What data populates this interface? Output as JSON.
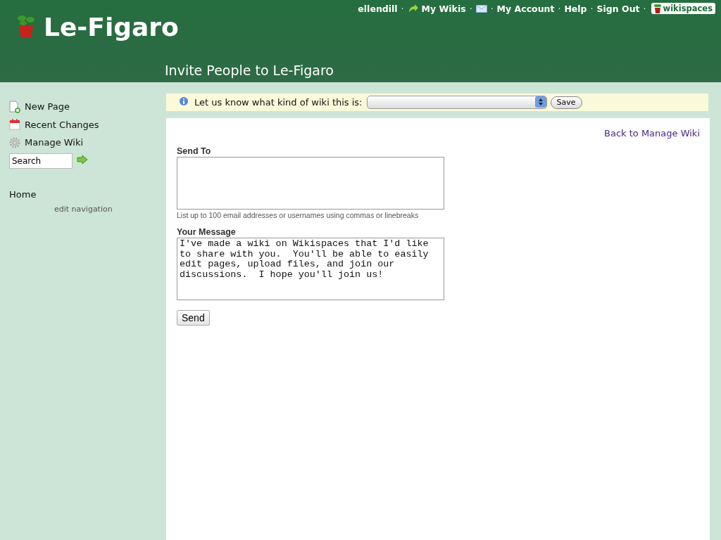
{
  "header": {
    "site_title": "Le-Figaro",
    "page_title": "Invite People to Le-Figaro",
    "user_nav": [
      {
        "kind": "user",
        "label": "ellendill"
      },
      {
        "kind": "separator",
        "label": "·"
      },
      {
        "kind": "arrow_link",
        "label": "My Wikis"
      },
      {
        "kind": "separator",
        "label": "·"
      },
      {
        "kind": "mail"
      },
      {
        "kind": "separator",
        "label": "·"
      },
      {
        "kind": "link",
        "label": "My Account"
      },
      {
        "kind": "separator",
        "label": "·"
      },
      {
        "kind": "link",
        "label": "Help"
      },
      {
        "kind": "separator",
        "label": "·"
      },
      {
        "kind": "link",
        "label": "Sign Out"
      },
      {
        "kind": "separator",
        "label": "·"
      },
      {
        "kind": "badge",
        "label": "wikispaces"
      }
    ]
  },
  "sidebar": {
    "actions": [
      {
        "label": "New Page"
      },
      {
        "label": "Recent Changes"
      },
      {
        "label": "Manage Wiki"
      }
    ],
    "search": {
      "value": "Search"
    },
    "nav": [
      {
        "label": "Home"
      }
    ],
    "edit_link": "edit navigation"
  },
  "notice": {
    "text": "Let us know what kind of wiki this is:",
    "button": "Save"
  },
  "content": {
    "back_link": "Back to Manage Wiki",
    "send_to": {
      "label": "Send To",
      "hint": "List up to 100 email addresses or usernames using commas or linebreaks"
    },
    "message": {
      "label": "Your Message",
      "value": "I've made a wiki on Wikispaces that I'd like to share with you.  You'll be able to easily edit pages, upload files, and join our discussions.  I hope you'll join us!"
    },
    "submit": "Send"
  }
}
